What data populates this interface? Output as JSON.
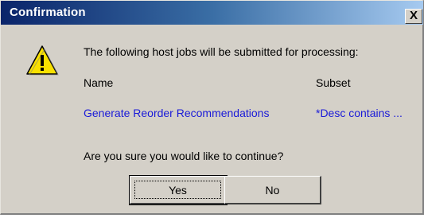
{
  "dialog": {
    "title": "Confirmation",
    "close_label": "X",
    "icon": "warning-icon",
    "message": "The following host jobs will be submitted for processing:",
    "columns": {
      "name_header": "Name",
      "subset_header": "Subset"
    },
    "jobs": [
      {
        "name": "Generate Reorder Recommendations",
        "subset": "*Desc contains ..."
      }
    ],
    "question": "Are you sure you would like to continue?",
    "buttons": {
      "yes": "Yes",
      "no": "No"
    }
  },
  "colors": {
    "title_bar_start": "#0a246a",
    "title_bar_end": "#a6caf0",
    "dialog_bg": "#d4d0c8",
    "job_text": "#1a1ad8",
    "warning_fill": "#f8e000"
  }
}
